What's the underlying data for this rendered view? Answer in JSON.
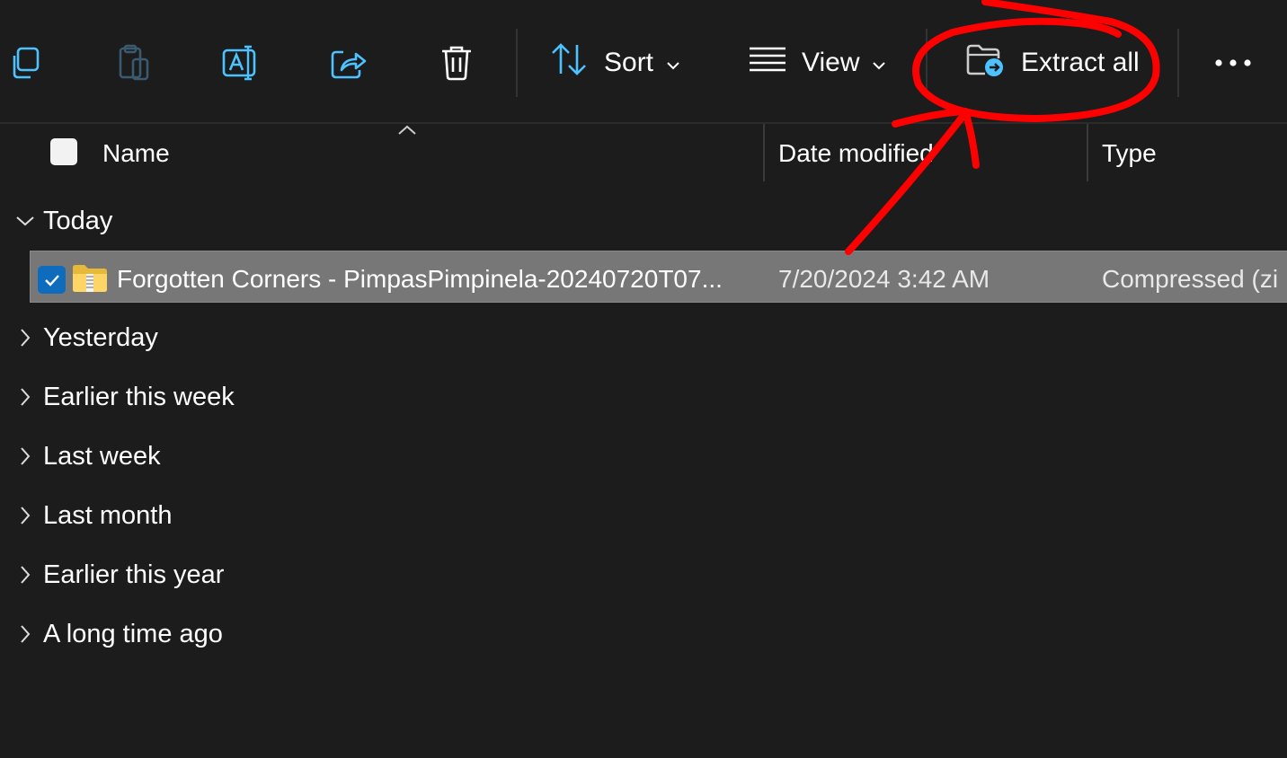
{
  "toolbar": {
    "sort_label": "Sort",
    "view_label": "View",
    "extract_label": "Extract all",
    "icons": [
      "copy-icon",
      "paste-icon",
      "rename-icon",
      "share-icon",
      "delete-icon",
      "sort-icon",
      "view-icon",
      "extract-folder-icon",
      "more-icon"
    ]
  },
  "columns": {
    "name": "Name",
    "date_modified": "Date modified",
    "type": "Type"
  },
  "groups": [
    {
      "label": "Today",
      "expanded": true
    },
    {
      "label": "Yesterday",
      "expanded": false
    },
    {
      "label": "Earlier this week",
      "expanded": false
    },
    {
      "label": "Last week",
      "expanded": false
    },
    {
      "label": "Last month",
      "expanded": false
    },
    {
      "label": "Earlier this year",
      "expanded": false
    },
    {
      "label": "A long time ago",
      "expanded": false
    }
  ],
  "files": [
    {
      "name": "Forgotten Corners - PimpasPimpinela-20240720T07...",
      "date_modified": "7/20/2024 3:42 AM",
      "type": "Compressed (zi",
      "selected": true
    }
  ],
  "colors": {
    "background": "#1c1c1c",
    "selected_row": "#777777",
    "accent": "#0f6cbd",
    "annotation": "#ff0000"
  }
}
